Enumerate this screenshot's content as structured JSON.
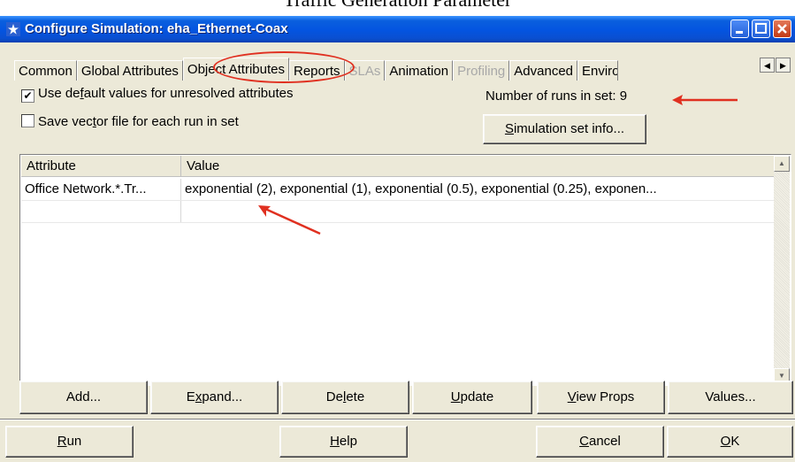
{
  "caption": "Traffic Generation Parameter",
  "window": {
    "title": "Configure Simulation: eha_Ethernet-Coax",
    "icon": "simulation-star-icon"
  },
  "tabs": [
    {
      "label": "Common",
      "state": "normal"
    },
    {
      "label": "Global Attributes",
      "state": "normal"
    },
    {
      "label": "Object Attributes",
      "state": "selected"
    },
    {
      "label": "Reports",
      "state": "normal"
    },
    {
      "label": "SLAs",
      "state": "disabled"
    },
    {
      "label": "Animation",
      "state": "normal"
    },
    {
      "label": "Profiling",
      "state": "disabled"
    },
    {
      "label": "Advanced",
      "state": "normal"
    },
    {
      "label": "Enviro",
      "state": "normal"
    }
  ],
  "options": {
    "use_default": {
      "label_pre": "Use de",
      "label_u": "f",
      "label_post": "ault values for unresolved attributes",
      "checked": true
    },
    "save_vector": {
      "label_pre": "Save vec",
      "label_u": "t",
      "label_post": "or file for each run in set",
      "checked": false
    }
  },
  "runs": {
    "label": "Number of runs in set:",
    "value": "9"
  },
  "sim_info_button": {
    "pre": "",
    "u": "S",
    "post": "imulation set info..."
  },
  "table": {
    "headers": [
      "Attribute",
      "Value"
    ],
    "rows": [
      {
        "attribute": "Office Network.*.Tr...",
        "value": "exponential (2), exponential (1), exponential (0.5), exponential (0.25), exponen..."
      }
    ]
  },
  "action_buttons": [
    {
      "name": "add-button",
      "pre": "Add...",
      "u": "",
      "post": ""
    },
    {
      "name": "expand-button",
      "pre": "E",
      "u": "x",
      "post": "pand..."
    },
    {
      "name": "delete-button",
      "pre": "De",
      "u": "l",
      "post": "ete"
    },
    {
      "name": "update-button",
      "pre": "",
      "u": "U",
      "post": "pdate"
    },
    {
      "name": "view-props-button",
      "pre": "",
      "u": "V",
      "post": "iew Props"
    },
    {
      "name": "values-button",
      "pre": "Values...",
      "u": "",
      "post": ""
    }
  ],
  "bottom_buttons": [
    {
      "name": "run-button",
      "pre": "",
      "u": "R",
      "post": "un"
    },
    {
      "name": "help-button",
      "pre": "",
      "u": "H",
      "post": "elp"
    },
    {
      "name": "cancel-button",
      "pre": "",
      "u": "C",
      "post": "ancel"
    },
    {
      "name": "ok-button",
      "pre": "",
      "u": "O",
      "post": "K"
    }
  ],
  "colors": {
    "annotation": "#e03020",
    "titlebar": "#0454e0"
  }
}
